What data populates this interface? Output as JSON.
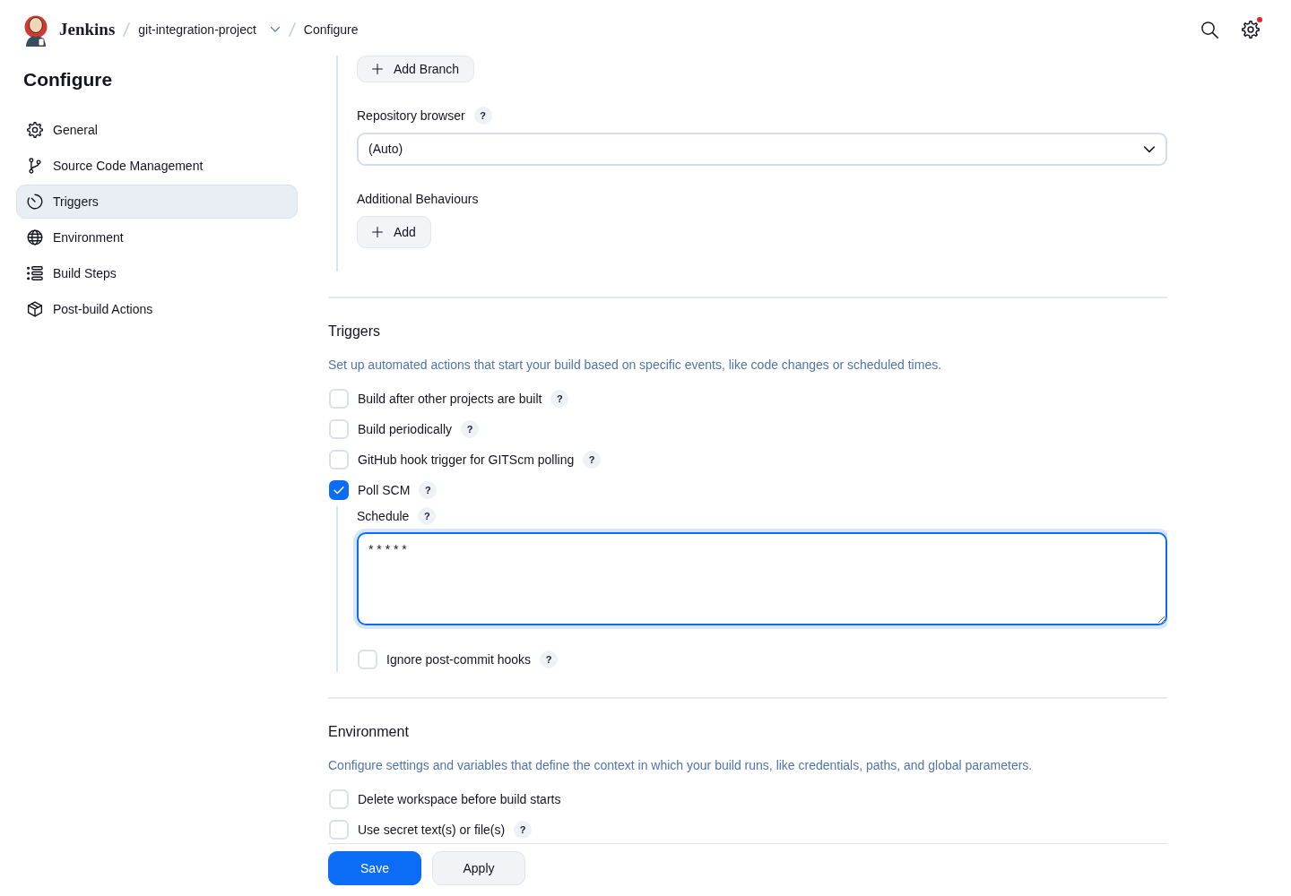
{
  "header": {
    "brand": "Jenkins",
    "breadcrumbs": [
      {
        "label": "git-integration-project",
        "dropdown": true
      },
      {
        "label": "Configure",
        "dropdown": false
      }
    ],
    "settings": {
      "notification": true
    }
  },
  "sidebar": {
    "title": "Configure",
    "items": [
      {
        "label": "General",
        "selected": false
      },
      {
        "label": "Source Code Management",
        "selected": false
      },
      {
        "label": "Triggers",
        "selected": true
      },
      {
        "label": "Environment",
        "selected": false
      },
      {
        "label": "Build Steps",
        "selected": false
      },
      {
        "label": "Post-build Actions",
        "selected": false
      }
    ]
  },
  "source_code_management": {
    "add_branch_button": "Add Branch",
    "repository_browser": {
      "label": "Repository browser",
      "help": "?",
      "value": "(Auto)"
    },
    "additional_behaviours": {
      "label": "Additional Behaviours",
      "add_button": "Add"
    }
  },
  "sections": [
    {
      "title": "Triggers",
      "description": "Set up automated actions that start your build based on specific events, like code changes or scheduled times.",
      "options": [
        {
          "label": "Build after other projects are built",
          "help": "?",
          "checked": false
        },
        {
          "label": "Build periodically",
          "help": "?",
          "checked": false
        },
        {
          "label": "GitHub hook trigger for GITScm polling",
          "help": "?",
          "checked": false
        },
        {
          "label": "Poll SCM",
          "help": "?",
          "checked": true,
          "schedule": {
            "label": "Schedule",
            "help": "?",
            "value": "* * * * *",
            "focused": true
          },
          "children": [
            {
              "label": "Ignore post-commit hooks",
              "help": "?",
              "checked": false
            }
          ]
        }
      ]
    },
    {
      "title": "Environment",
      "description": "Configure settings and variables that define the context in which your build runs, like credentials, paths, and global parameters.",
      "options": [
        {
          "label": "Delete workspace before build starts",
          "checked": false
        },
        {
          "label": "Use secret text(s) or file(s)",
          "help": "?",
          "checked": false
        }
      ]
    }
  ],
  "actions": [
    {
      "label": "Save",
      "kind": "primary"
    },
    {
      "label": "Apply",
      "kind": "secondary"
    }
  ]
}
